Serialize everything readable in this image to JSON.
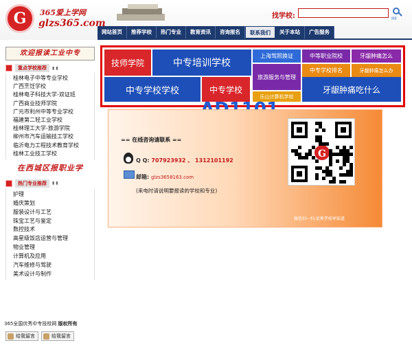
{
  "header": {
    "logo_letter": "G",
    "logo_line1": "365爱上学网",
    "logo_line2": "glzs365.com",
    "search_label": "找学校:",
    "search_value": "",
    "search_btn_caption": "搜索",
    "nav": [
      {
        "label": "网站首页"
      },
      {
        "label": "推荐学校"
      },
      {
        "label": "热门专业"
      },
      {
        "label": "教育资讯"
      },
      {
        "label": "咨询报名"
      },
      {
        "label": "联系我们",
        "active": true
      },
      {
        "label": "关于本站"
      },
      {
        "label": "广告服务"
      }
    ]
  },
  "sidebar": {
    "banner_top": "欢迎报读工业中专",
    "recommend_title": "重点学校推荐",
    "schools": [
      "桂林电子中等专业学校",
      "广西烹饪学校",
      "桂林电子科技大学-双证班",
      "广西商业技师学院",
      "广元市利州中等专业学校",
      "福建第二轻工业学校",
      "桂林理工大学-旅游学院",
      "柳州市汽车运输技工学校",
      "临沂电力工程技术教育学校",
      "桂林工业技工学校"
    ],
    "banner_mid": "在西城区报职业学",
    "majors_title": "热门专业推荐",
    "majors": [
      "护理",
      "婚庆策划",
      "服装设计与工艺",
      "珠宝工艺与鉴定",
      "数控技术",
      "高星级饭店运营与管理",
      "物业管理",
      "计算机及应用",
      "汽车维修与驾驶",
      "美术设计与制作"
    ]
  },
  "ads": {
    "items": [
      {
        "text": "技师学院",
        "bg": "#d8262a"
      },
      {
        "text": "中专培训学校",
        "bg": "#1e4fb8"
      },
      {
        "text": "上海驾照换证",
        "bg": "#2f6bd8"
      },
      {
        "text": "中等职业院校",
        "bg": "#7a2aa8"
      },
      {
        "text": "牙龈肿痛怎么",
        "bg": "#8a2aa8"
      },
      {
        "text": "旅游服务与管理",
        "bg": "#7a2aa8"
      },
      {
        "text": "中专学校排名",
        "bg": "#e98a14"
      },
      {
        "text": "牙龈肿痛怎么办",
        "bg": "#e98a14"
      },
      {
        "text": "中专学校学校",
        "bg": "#1e4fb8"
      },
      {
        "text": "中专学校",
        "bg": "#d8262a"
      },
      {
        "text": "乐山计算机学校",
        "bg": "#e8a010"
      },
      {
        "text": "牙龈肿痛吃什么",
        "bg": "#1e4fb8"
      }
    ],
    "ad_id": "AD1101"
  },
  "contact": {
    "title": "== 在线咨询请联系 ==",
    "qq_label": "Q Q:",
    "qq_value": "707923932 、 1312101192",
    "mail_label": "邮箱:",
    "mail_value": "glzs3658163.com",
    "note": "(来电时请说明要报读的学校和专业)",
    "qr_caption": "微信扫一扫,优秀学校早知道"
  },
  "footer": {
    "copyright_site": "365全国优秀中专技校网",
    "copyright_rights": "版权所有",
    "msg_button_1": "给我留言",
    "msg_button_2": "给我留言"
  }
}
